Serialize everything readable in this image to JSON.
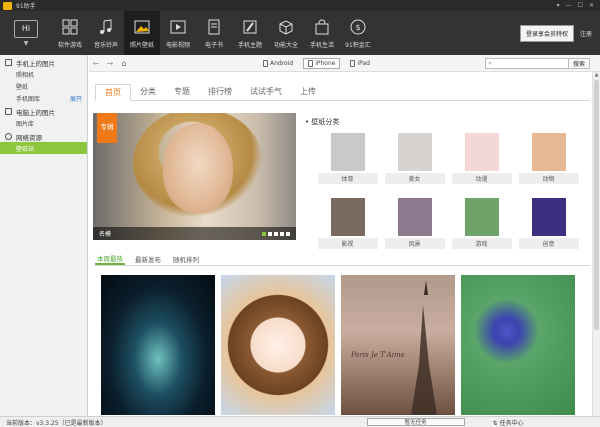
{
  "titlebar": {
    "title": "91助手",
    "controls": [
      "▾",
      "—",
      "☐",
      "✕"
    ]
  },
  "toolbar": {
    "hi_label": "Hi",
    "items": [
      {
        "label": "软件游戏",
        "icon": "grid-icon"
      },
      {
        "label": "音乐铃声",
        "icon": "music-note-icon"
      },
      {
        "label": "照片壁纸",
        "icon": "photo-icon",
        "active": true
      },
      {
        "label": "电影视频",
        "icon": "film-icon"
      },
      {
        "label": "电子书",
        "icon": "book-icon"
      },
      {
        "label": "手机主题",
        "icon": "brush-icon"
      },
      {
        "label": "功能大全",
        "icon": "box-icon"
      },
      {
        "label": "手机生活",
        "icon": "bag-icon"
      },
      {
        "label": "91积金汇",
        "icon": "coin-icon"
      }
    ],
    "vip_button": "登录享会员特权",
    "logout": "注册"
  },
  "sidebar": {
    "sections": [
      {
        "title": "手机上的图片",
        "items": [
          {
            "label": "照相机"
          },
          {
            "label": "壁纸"
          },
          {
            "label": "手机图库",
            "extra": "展开"
          }
        ]
      },
      {
        "title": "电脑上的图片",
        "items": [
          {
            "label": "图片库"
          }
        ]
      },
      {
        "title": "网络资源",
        "items": [
          {
            "label": "壁纸站",
            "active": true
          }
        ]
      }
    ]
  },
  "nav": {
    "back": "←",
    "forward": "→",
    "home": "⌂",
    "devices": [
      "Android",
      "iPhone",
      "iPad"
    ],
    "search_placeholder": "",
    "search_icon": "⌕",
    "search_button": "搜索"
  },
  "tabs": [
    "首页",
    "分类",
    "专题",
    "排行榜",
    "试试手气",
    "上传"
  ],
  "banner": {
    "tag": "专辑",
    "caption": "名模"
  },
  "categories": {
    "title": "壁纸分类",
    "items": [
      {
        "label": "体育",
        "color": "#c9c9c9"
      },
      {
        "label": "美女",
        "color": "#d7d3cf"
      },
      {
        "label": "动漫",
        "color": "#f3d7d5"
      },
      {
        "label": "动物",
        "color": "#e5b993"
      },
      {
        "label": "影视",
        "color": "#7b6a5f"
      },
      {
        "label": "风景",
        "color": "#8d7a8f"
      },
      {
        "label": "游戏",
        "color": "#6ea46a"
      },
      {
        "label": "创意",
        "color": "#3c2f82"
      }
    ]
  },
  "sort_tabs": [
    "本周最热",
    "最新发布",
    "随机排列"
  ],
  "wallpapers": [
    {
      "name": "wallpaper-ocean-night",
      "text": ""
    },
    {
      "name": "wallpaper-cartoon-girl",
      "text": ""
    },
    {
      "name": "wallpaper-eiffel-tower",
      "text": "Paris Je T'Aime"
    },
    {
      "name": "wallpaper-blue-flowers",
      "text": ""
    }
  ],
  "status": {
    "version": "当前版本：v3.3.25（已是最新版本）",
    "task": "暂无任务",
    "percent": "",
    "task_center": "任务中心"
  }
}
